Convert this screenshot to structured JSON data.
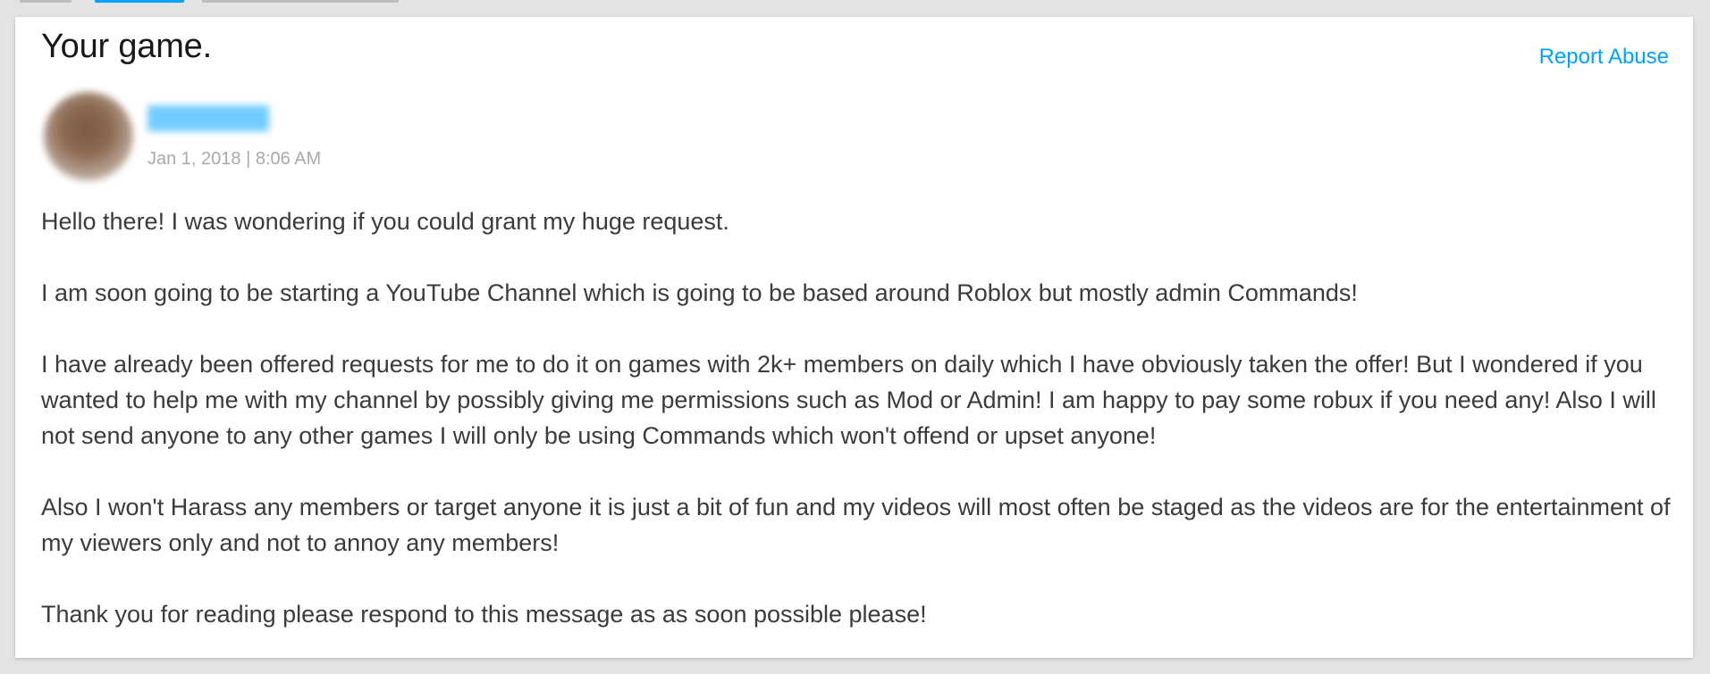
{
  "message": {
    "subject": "Your game.",
    "report_label": "Report Abuse",
    "sender_name": "████████",
    "timestamp": "Jan 1, 2018 | 8:06 AM",
    "body": [
      "Hello there! I was wondering if you could grant my huge request.",
      "I am soon going to be starting a YouTube Channel which is going to be based around Roblox but mostly admin Commands!",
      "I have already been offered requests for me to do it on games with 2k+ members on daily which I have obviously taken the offer! But I wondered if you wanted to help me with my channel by possibly giving me permissions such as Mod or Admin! I am happy to pay some robux if you need any! Also I will not send anyone to any other games I will only be using Commands which won't offend or upset anyone!",
      "Also I won't Harass any members or target anyone it is just a bit of fun and my videos will most often be staged as the videos are for the entertainment of my viewers only and not to annoy any members!",
      "Thank you for reading please respond to this message as as soon possible please!"
    ]
  },
  "colors": {
    "link": "#00a2ff",
    "text": "#393b3d",
    "muted": "#a9a9a9",
    "background": "#e3e3e3"
  }
}
